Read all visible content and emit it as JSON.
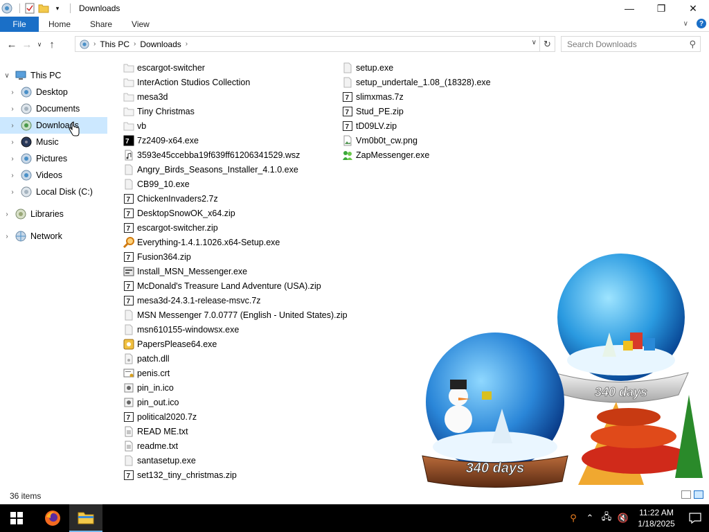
{
  "window": {
    "title": "Downloads"
  },
  "ribbon": {
    "file_label": "File",
    "tabs": [
      "Home",
      "Share",
      "View"
    ]
  },
  "address": {
    "crumbs": [
      "This PC",
      "Downloads"
    ]
  },
  "search": {
    "placeholder": "Search Downloads"
  },
  "nav": {
    "this_pc": "This PC",
    "items": [
      "Desktop",
      "Documents",
      "Downloads",
      "Music",
      "Pictures",
      "Videos",
      "Local Disk (C:)"
    ],
    "libraries": "Libraries",
    "network": "Network"
  },
  "files": {
    "column1": [
      {
        "name": "escargot-switcher",
        "icon": "folder-icon"
      },
      {
        "name": "InterAction Studios Collection",
        "icon": "folder-icon"
      },
      {
        "name": "mesa3d",
        "icon": "folder-icon"
      },
      {
        "name": "Tiny Christmas",
        "icon": "folder-icon"
      },
      {
        "name": "vb",
        "icon": "folder-icon"
      },
      {
        "name": "7z2409-x64.exe",
        "icon": "7zip-icon"
      },
      {
        "name": "3593e45ccebba19f639ff61206341529.wsz",
        "icon": "audio-file-icon"
      },
      {
        "name": "Angry_Birds_Seasons_Installer_4.1.0.exe",
        "icon": "exe-icon"
      },
      {
        "name": "CB99_10.exe",
        "icon": "exe-icon"
      },
      {
        "name": "ChickenInvaders2.7z",
        "icon": "archive-icon"
      },
      {
        "name": "DesktopSnowOK_x64.zip",
        "icon": "archive-icon"
      },
      {
        "name": "escargot-switcher.zip",
        "icon": "archive-icon"
      },
      {
        "name": "Everything-1.4.1.1026.x64-Setup.exe",
        "icon": "magnifier-icon"
      },
      {
        "name": "Fusion364.zip",
        "icon": "archive-icon"
      },
      {
        "name": "Install_MSN_Messenger.exe",
        "icon": "installer-icon"
      },
      {
        "name": "McDonald's Treasure Land Adventure (USA).zip",
        "icon": "archive-icon"
      },
      {
        "name": "mesa3d-24.3.1-release-msvc.7z",
        "icon": "archive-icon"
      },
      {
        "name": "MSN Messenger 7.0.0777 (English - United States).zip",
        "icon": "exe-icon"
      },
      {
        "name": "msn610155-windowsx.exe",
        "icon": "exe-icon"
      },
      {
        "name": "PapersPlease64.exe",
        "icon": "papers-please-icon"
      },
      {
        "name": "patch.dll",
        "icon": "dll-icon"
      },
      {
        "name": "penis.crt",
        "icon": "certificate-icon"
      },
      {
        "name": "pin_in.ico",
        "icon": "ico-file-icon"
      },
      {
        "name": "pin_out.ico",
        "icon": "ico-file-icon"
      },
      {
        "name": "political2020.7z",
        "icon": "archive-icon"
      },
      {
        "name": "READ ME.txt",
        "icon": "text-file-icon"
      },
      {
        "name": "readme.txt",
        "icon": "text-file-icon"
      },
      {
        "name": "santasetup.exe",
        "icon": "exe-icon"
      },
      {
        "name": "set132_tiny_christmas.zip",
        "icon": "archive-icon"
      }
    ],
    "column2": [
      {
        "name": "setup.exe",
        "icon": "exe-icon"
      },
      {
        "name": "setup_undertale_1.08_(18328).exe",
        "icon": "exe-icon"
      },
      {
        "name": "slimxmas.7z",
        "icon": "archive-icon"
      },
      {
        "name": "Stud_PE.zip",
        "icon": "archive-icon"
      },
      {
        "name": "tD09LV.zip",
        "icon": "archive-icon"
      },
      {
        "name": "Vm0b0t_cw.png",
        "icon": "image-file-icon"
      },
      {
        "name": "ZapMessenger.exe",
        "icon": "messenger-icon"
      }
    ]
  },
  "status": {
    "item_count": "36 items"
  },
  "globes": {
    "left_label": "340 days",
    "right_label": "340 days"
  },
  "taskbar": {
    "time": "11:22 AM",
    "date": "1/18/2025"
  },
  "colors": {
    "accent": "#1a6fc7",
    "selection": "#cce8ff",
    "taskbar": "#000000"
  }
}
